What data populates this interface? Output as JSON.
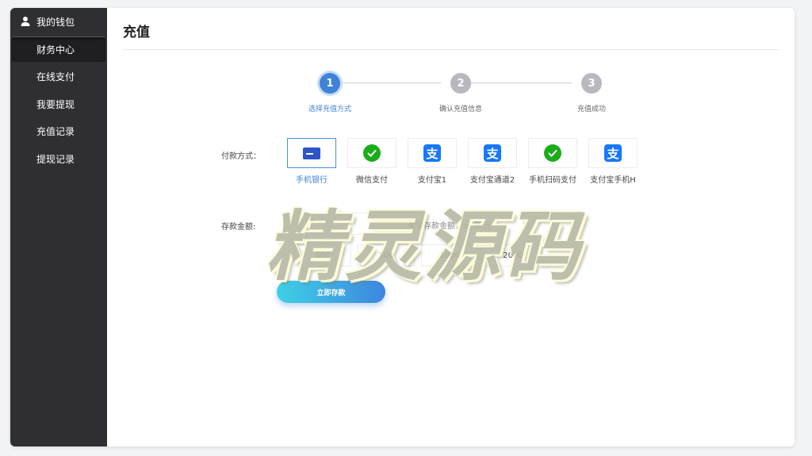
{
  "sidebar": {
    "header": "我的钱包",
    "items": [
      {
        "label": "财务中心",
        "active": true
      },
      {
        "label": "在线支付",
        "active": false
      },
      {
        "label": "我要提现",
        "active": false
      },
      {
        "label": "充值记录",
        "active": false
      },
      {
        "label": "提现记录",
        "active": false
      }
    ]
  },
  "page": {
    "title": "充值"
  },
  "steps": [
    {
      "number": "1",
      "label": "选择充值方式",
      "active": true
    },
    {
      "number": "2",
      "label": "确认充值信息",
      "active": false
    },
    {
      "number": "3",
      "label": "充值成功",
      "active": false
    }
  ],
  "payment": {
    "label": "付款方式：",
    "methods": [
      {
        "name": "手机银行",
        "icon": "bank-card-icon",
        "selected": true
      },
      {
        "name": "微信支付",
        "icon": "wechat-icon",
        "selected": false
      },
      {
        "name": "支付宝1",
        "icon": "alipay-icon",
        "selected": false
      },
      {
        "name": "支付宝通道2",
        "icon": "alipay-icon",
        "selected": false
      },
      {
        "name": "手机扫码支付",
        "icon": "wechat-icon",
        "selected": false
      },
      {
        "name": "支付宝手机H",
        "icon": "alipay-icon",
        "selected": false
      }
    ]
  },
  "deposit": {
    "label": "存款金额:",
    "value": "",
    "hint": "单笔存款金额：元 至 元",
    "quick_amounts": [
      "100",
      "500",
      "1000",
      "2000"
    ],
    "submit_label": "立即存款"
  },
  "watermark": "精灵源码",
  "colors": {
    "sidebar_bg": "#2f2f33",
    "accent": "#3e83d8",
    "wechat_green": "#1aad19",
    "alipay_blue": "#1677ff"
  }
}
